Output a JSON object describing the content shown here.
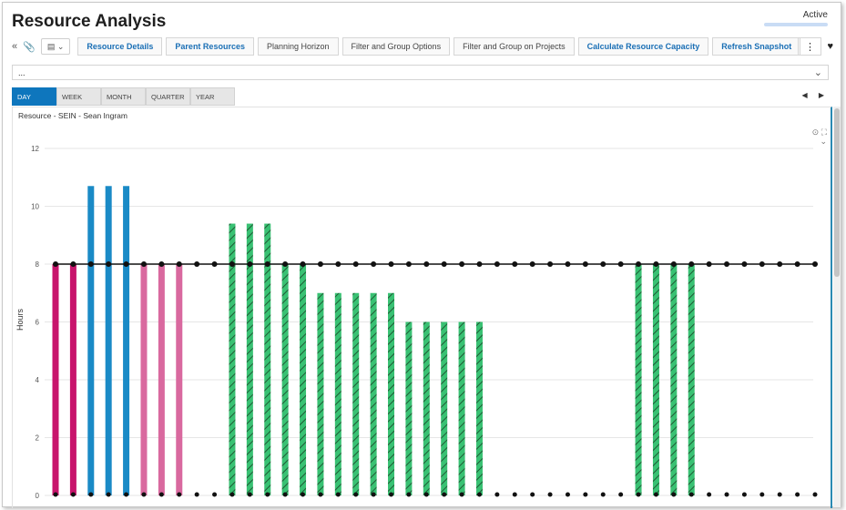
{
  "header": {
    "title": "Resource Analysis",
    "status": "Active"
  },
  "toolbar": {
    "collapse_icon": "«",
    "attach_icon": "📎",
    "dropdown_icon": "▤ ⌄",
    "buttons": [
      {
        "label": "Resource Details",
        "style": "blue"
      },
      {
        "label": "Parent Resources",
        "style": "blue"
      },
      {
        "label": "Planning Horizon",
        "style": "plain"
      },
      {
        "label": "Filter and Group Options",
        "style": "plain"
      },
      {
        "label": "Filter and Group on Projects",
        "style": "plain"
      },
      {
        "label": "Calculate Resource Capacity",
        "style": "blue"
      },
      {
        "label": "Refresh Snapshot",
        "style": "blue"
      }
    ],
    "more_icon": "⋮",
    "favorite_icon": "♥"
  },
  "selector": {
    "value": "...",
    "chevron": "⌄"
  },
  "tabs": [
    {
      "label": "DAY",
      "active": true
    },
    {
      "label": "WEEK",
      "active": false
    },
    {
      "label": "MONTH",
      "active": false
    },
    {
      "label": "QUARTER",
      "active": false
    },
    {
      "label": "YEAR",
      "active": false
    }
  ],
  "nav": {
    "prev": "◀",
    "next": "▶"
  },
  "chart_icons": {
    "reset": "⊙",
    "fullscreen": "⛶",
    "collapse": "⌄"
  },
  "chart_data": {
    "title": "Resource - SEIN - Sean Ingram",
    "type": "bar",
    "ylabel": "Hours",
    "ylim": [
      0,
      12
    ],
    "yticks": [
      0,
      2,
      4,
      6,
      8,
      10,
      12
    ],
    "grid": true,
    "categories_count": 44,
    "values": [
      8,
      8,
      10.7,
      10.7,
      10.7,
      8,
      8,
      8,
      0,
      0,
      9.4,
      9.4,
      9.4,
      8,
      8,
      7,
      7,
      7,
      7,
      7,
      6,
      6,
      6,
      6,
      6,
      0,
      0,
      0,
      0,
      0,
      0,
      0,
      0,
      8,
      8,
      8,
      8,
      0,
      0,
      0,
      0,
      0,
      0,
      0
    ],
    "colors": [
      "#c8146c",
      "#c8146c",
      "#1a8ac6",
      "#1a8ac6",
      "#1a8ac6",
      "#d9699f",
      "#d9699f",
      "#d9699f",
      "",
      "",
      "hatch",
      "hatch",
      "hatch",
      "hatch",
      "hatch",
      "hatch",
      "hatch",
      "hatch",
      "hatch",
      "hatch",
      "hatch",
      "hatch",
      "hatch",
      "hatch",
      "hatch",
      "",
      "",
      "",
      "",
      "",
      "",
      "",
      "",
      "hatch",
      "hatch",
      "hatch",
      "hatch",
      "",
      "",
      "",
      "",
      "",
      "",
      ""
    ],
    "capacity": 8,
    "capacity_color": "#111111",
    "hatch_color": "#39c173"
  }
}
